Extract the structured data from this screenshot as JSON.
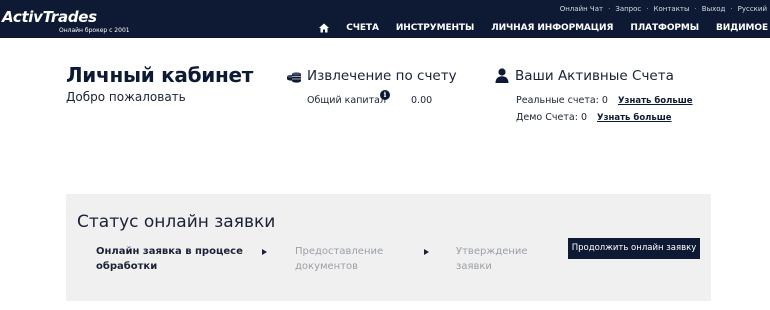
{
  "brand": {
    "logo_text": "ActivTrades",
    "tagline": "Онлайн брокер с 2001"
  },
  "utility_links": [
    "Онлайн Чат",
    "Запрос",
    "Контакты",
    "Выход",
    "Русский"
  ],
  "nav": {
    "home_icon": "home-icon",
    "items": [
      "СЧЕТА",
      "ИНСТРУМЕНТЫ",
      "ЛИЧНАЯ ИНФОРМАЦИЯ",
      "ПЛАТФОРМЫ",
      "ВИДИМОЕ"
    ]
  },
  "cabinet": {
    "title": "Личный кабинет",
    "welcome": "Добро пожаловать"
  },
  "summary": {
    "icon": "coins-icon",
    "title": "Извлечение по счету",
    "capital_label": "Общий капитал",
    "capital_value": "0.00"
  },
  "accounts": {
    "icon": "user-icon",
    "title": "Ваши Активные Счета",
    "real_label": "Реальные счета:",
    "real_count": "0",
    "demo_label": "Демо Счета:",
    "demo_count": "0",
    "learn_more": "Узнать больше"
  },
  "status": {
    "title": "Статус онлайн заявки",
    "steps": [
      {
        "line1": "Онлайн заявка в процесе",
        "line2": "обработки"
      },
      {
        "line1": "Предоставление",
        "line2": "документов"
      },
      {
        "line1": "Утверждение",
        "line2": "заявки"
      }
    ],
    "continue_button": "Продолжить онлайн заявку"
  },
  "colors": {
    "header_bg": "#0e1a33",
    "panel_bg": "#f0f0f0",
    "muted_text": "#9aa0a8"
  }
}
